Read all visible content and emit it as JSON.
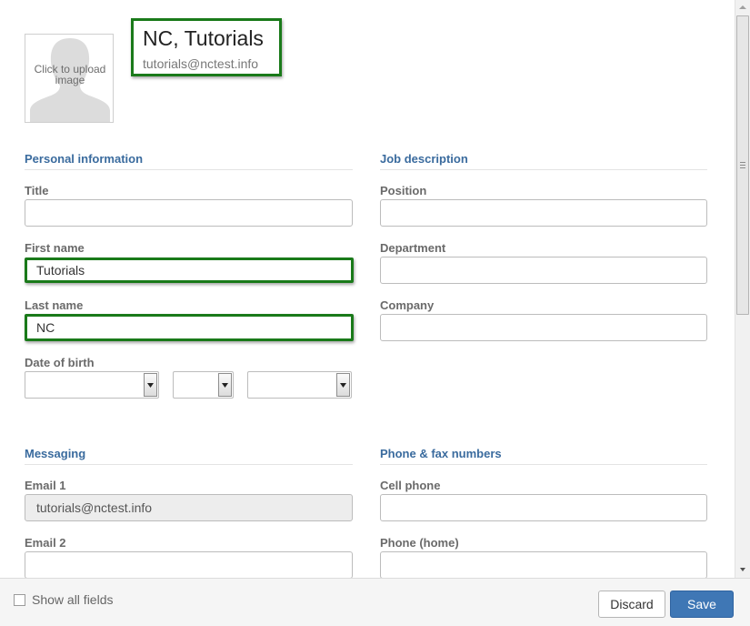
{
  "profile": {
    "avatar_text": "Click to upload image",
    "display_name": "NC, Tutorials",
    "email": "tutorials@nctest.info"
  },
  "sections": {
    "personal": {
      "heading": "Personal information",
      "title_label": "Title",
      "title_value": "",
      "first_name_label": "First name",
      "first_name_value": "Tutorials",
      "last_name_label": "Last name",
      "last_name_value": "NC",
      "dob_label": "Date of birth"
    },
    "job": {
      "heading": "Job description",
      "position_label": "Position",
      "department_label": "Department",
      "company_label": "Company"
    },
    "messaging": {
      "heading": "Messaging",
      "email1_label": "Email 1",
      "email1_value": "tutorials@nctest.info",
      "email2_label": "Email 2"
    },
    "phone": {
      "heading": "Phone & fax numbers",
      "cell_label": "Cell phone",
      "home_label": "Phone (home)"
    }
  },
  "footer": {
    "show_all_label": "Show all fields",
    "discard_label": "Discard",
    "save_label": "Save"
  },
  "colors": {
    "accent": "#3a6b9e",
    "highlight": "#1a7a1a",
    "save": "#3f77b5"
  }
}
